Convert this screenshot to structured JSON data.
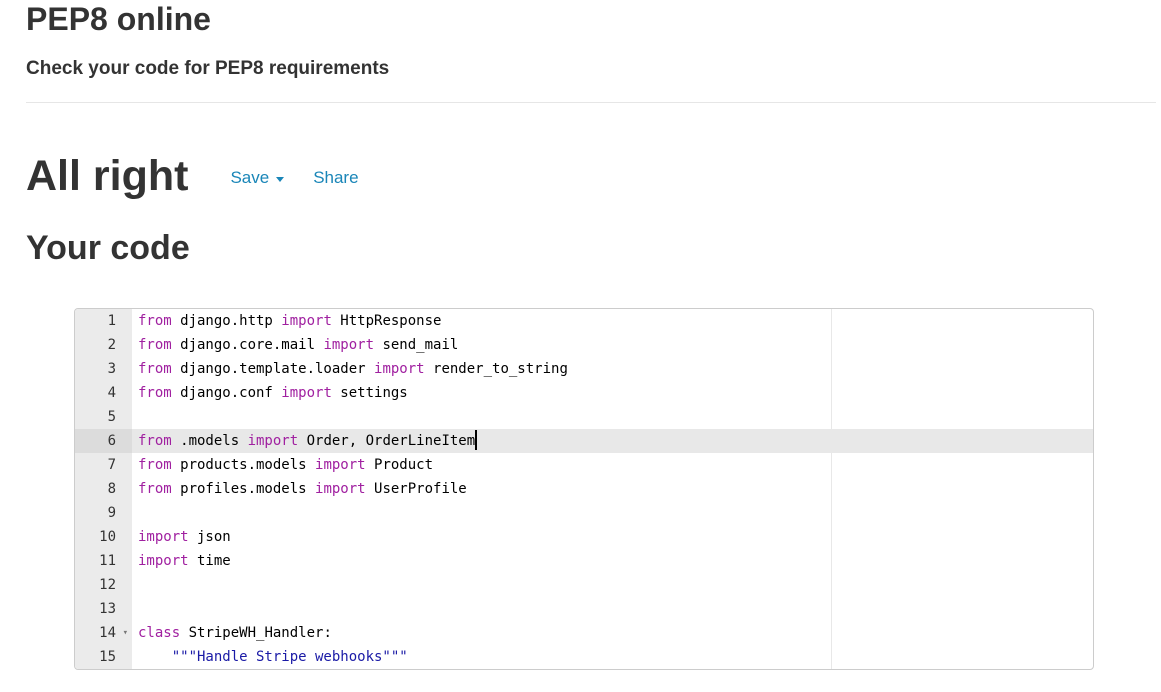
{
  "header": {
    "title": "PEP8 online",
    "subtitle": "Check your code for PEP8 requirements"
  },
  "result": {
    "title": "All right",
    "save_label": "Save",
    "share_label": "Share"
  },
  "section": {
    "title": "Your code"
  },
  "editor": {
    "active_line": 6,
    "lines": [
      {
        "n": "1",
        "code": [
          [
            "kw",
            "from"
          ],
          [
            "t",
            " django.http "
          ],
          [
            "kw",
            "import"
          ],
          [
            "t",
            " HttpResponse"
          ]
        ]
      },
      {
        "n": "2",
        "code": [
          [
            "kw",
            "from"
          ],
          [
            "t",
            " django.core.mail "
          ],
          [
            "kw",
            "import"
          ],
          [
            "t",
            " send_mail"
          ]
        ]
      },
      {
        "n": "3",
        "code": [
          [
            "kw",
            "from"
          ],
          [
            "t",
            " django.template.loader "
          ],
          [
            "kw",
            "import"
          ],
          [
            "t",
            " render_to_string"
          ]
        ]
      },
      {
        "n": "4",
        "code": [
          [
            "kw",
            "from"
          ],
          [
            "t",
            " django.conf "
          ],
          [
            "kw",
            "import"
          ],
          [
            "t",
            " settings"
          ]
        ]
      },
      {
        "n": "5",
        "code": []
      },
      {
        "n": "6",
        "code": [
          [
            "kw",
            "from"
          ],
          [
            "t",
            " .models "
          ],
          [
            "kw",
            "import"
          ],
          [
            "t",
            " Order, OrderLineItem"
          ]
        ]
      },
      {
        "n": "7",
        "code": [
          [
            "kw",
            "from"
          ],
          [
            "t",
            " products.models "
          ],
          [
            "kw",
            "import"
          ],
          [
            "t",
            " Product"
          ]
        ]
      },
      {
        "n": "8",
        "code": [
          [
            "kw",
            "from"
          ],
          [
            "t",
            " profiles.models "
          ],
          [
            "kw",
            "import"
          ],
          [
            "t",
            " UserProfile"
          ]
        ]
      },
      {
        "n": "9",
        "code": []
      },
      {
        "n": "10",
        "code": [
          [
            "kw",
            "import"
          ],
          [
            "t",
            " json"
          ]
        ]
      },
      {
        "n": "11",
        "code": [
          [
            "kw",
            "import"
          ],
          [
            "t",
            " time"
          ]
        ]
      },
      {
        "n": "12",
        "code": []
      },
      {
        "n": "13",
        "code": []
      },
      {
        "n": "14",
        "fold": true,
        "code": [
          [
            "kw",
            "class"
          ],
          [
            "t",
            " StripeWH_Handler:"
          ]
        ]
      },
      {
        "n": "15",
        "code": [
          [
            "t",
            "    "
          ],
          [
            "str",
            "\"\"\"Handle Stripe webhooks\"\"\""
          ]
        ]
      }
    ]
  }
}
